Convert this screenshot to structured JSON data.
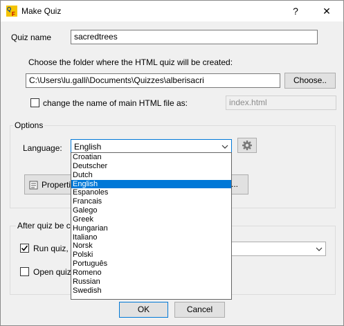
{
  "window": {
    "title": "Make Quiz",
    "help": "?",
    "close": "✕"
  },
  "quiz_name": {
    "label": "Quiz name",
    "value": "sacredtrees"
  },
  "folder": {
    "prompt": "Choose the folder where the HTML quiz will be created:",
    "path": "C:\\Users\\lu.galli\\Documents\\Quizzes\\alberisacri",
    "choose_label": "Choose.."
  },
  "main_file": {
    "label": "change the name of main HTML file as:",
    "value": "index.html",
    "checked": false
  },
  "options": {
    "group_label": "Options",
    "language_label": "Language:",
    "language_value": "English",
    "properties_label": "Properti",
    "more_label": "..."
  },
  "language_list": [
    "Croatian",
    "Deutscher",
    "Dutch",
    "English",
    "Espanoles",
    "Francais",
    "Galego",
    "Greek",
    "Hungarian",
    "Italiano",
    "Norsk",
    "Polski",
    "Português",
    "Romeno",
    "Russian",
    "Swedish"
  ],
  "selected_language": "English",
  "after": {
    "group_label": "After quiz be cre",
    "run_label": "Run quiz, u",
    "run_checked": true,
    "open_label": "Open quiz f",
    "open_checked": false
  },
  "buttons": {
    "ok": "OK",
    "cancel": "Cancel"
  },
  "colors": {
    "accent": "#0078d7"
  }
}
